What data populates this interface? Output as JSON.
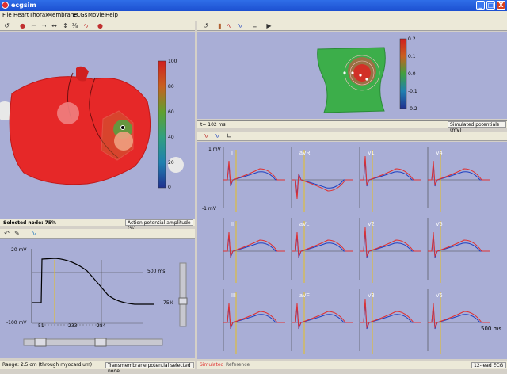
{
  "window": {
    "title": "ecgsim",
    "btn_min": "_",
    "btn_max": "□",
    "btn_close": "X"
  },
  "menu": [
    "File",
    "Heart",
    "Thorax",
    "Membrane",
    "ECGs",
    "Movie",
    "Help"
  ],
  "heart_panel": {
    "colorbar": [
      "100",
      "80",
      "60",
      "40",
      "20",
      "0"
    ],
    "status_left": "Selected node:  75%",
    "status_right": "Action potential amplitude (%)"
  },
  "torso_panel": {
    "colorbar": [
      "0.2",
      "0.1",
      "0.0",
      "-0.1",
      "-0.2"
    ],
    "time_label": "t= 102 ms",
    "status_right": "Simulated potentials (mV)"
  },
  "ap_panel": {
    "y_top": "20 mV",
    "y_bottom": "-100 mV",
    "x_unit": "500 ms",
    "level": "75%",
    "markers": [
      "51",
      "233",
      "284"
    ],
    "status_left": "Range: 2.5 cm (through myocardium)",
    "status_right": "Transmembrane potential selected node"
  },
  "ecg_panel": {
    "leads": [
      "I",
      "aVR",
      "V1",
      "V4",
      "II",
      "aVL",
      "V2",
      "V5",
      "III",
      "aVF",
      "V3",
      "V6"
    ],
    "y_top": "1 mV",
    "y_bottom": "-1 mV",
    "x_unit": "500 ms",
    "legend_sim": "Simulated",
    "legend_ref": "Reference",
    "status_right": "12-lead ECG"
  },
  "colors": {
    "sim": "#e03030",
    "ref": "#2040c0",
    "marker": "#e8c020"
  }
}
